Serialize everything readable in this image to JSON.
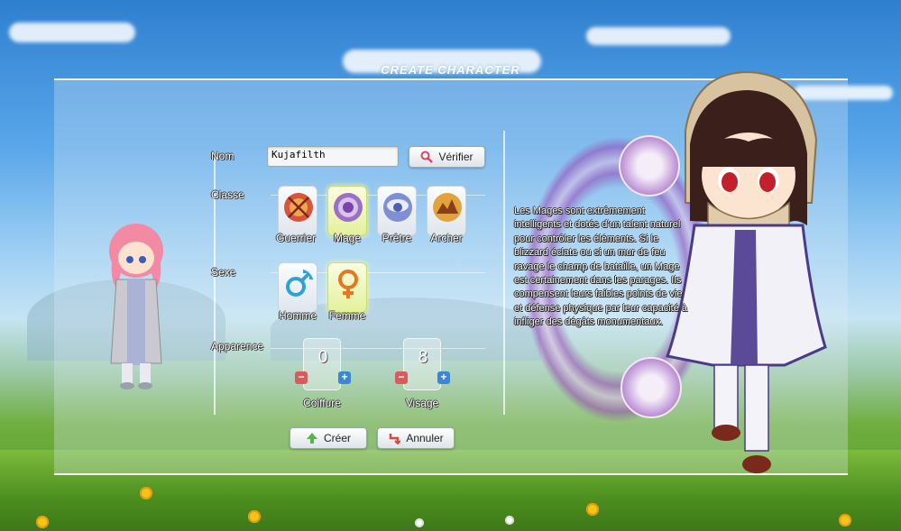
{
  "title": "CREATE CHARACTER",
  "form": {
    "name_label": "Nom",
    "name_value": "Kujafilth",
    "verify_label": "Vérifier",
    "class_label": "Classe",
    "classes": [
      {
        "label": "Guerrier",
        "selected": false,
        "icon": "sword-shield-icon"
      },
      {
        "label": "Mage",
        "selected": true,
        "icon": "magic-orb-icon"
      },
      {
        "label": "Prêtre",
        "selected": false,
        "icon": "priest-emblem-icon"
      },
      {
        "label": "Archer",
        "selected": false,
        "icon": "bow-emblem-icon"
      }
    ],
    "sex_label": "Sexe",
    "sexes": [
      {
        "label": "Homme",
        "selected": false,
        "icon": "male-symbol-icon",
        "color": "#2aa3d8"
      },
      {
        "label": "Femme",
        "selected": true,
        "icon": "female-symbol-icon",
        "color": "#e8761c"
      }
    ],
    "appearance_label": "Apparence",
    "hair_value": "0",
    "hair_label": "Coiffure",
    "face_value": "8",
    "face_label": "Visage",
    "create_label": "Créer",
    "cancel_label": "Annuler"
  },
  "description": "Les Mages sont extrêmement intelligents et dotés d'un talent naturel pour contrôler les éléments. Si le blizzard éclate ou si un mur de feu ravage le champ de bataille, un Mage est certainement dans les parages. Ils compensent leurs faibles points de vie et défense physique par leur capacité à infliger des dégâts monumentaux.",
  "colors": {
    "selected_slot": "#e3f19b",
    "minus": "#d95b5b",
    "plus": "#3c86d6",
    "magic_purple": "#8a4ab0"
  }
}
